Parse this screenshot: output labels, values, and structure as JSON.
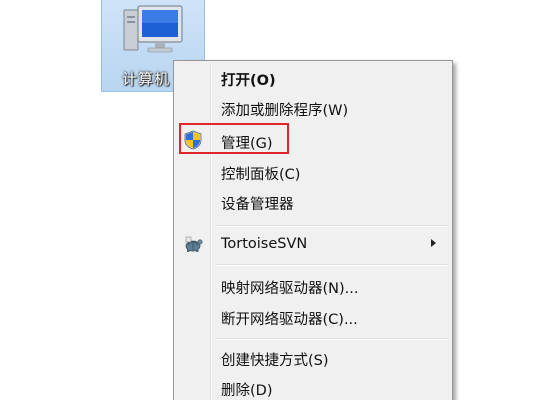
{
  "desktop": {
    "computer_label": "计算机"
  },
  "context_menu": {
    "items": [
      {
        "label": "打开(O)"
      },
      {
        "label": "添加或删除程序(W)"
      },
      {
        "label": "管理(G)"
      },
      {
        "label": "控制面板(C)"
      },
      {
        "label": "设备管理器"
      },
      {
        "label": "TortoiseSVN"
      },
      {
        "label": "映射网络驱动器(N)..."
      },
      {
        "label": "断开网络驱动器(C)..."
      },
      {
        "label": "创建快捷方式(S)"
      },
      {
        "label": "删除(D)"
      }
    ]
  },
  "icons": {
    "manage": "uac-shield-icon",
    "tortoisesvn": "tortoise-icon",
    "submenu": "submenu-arrow-icon"
  },
  "colors": {
    "highlight": "#e0262b",
    "menu_background": "#f0f0f0",
    "selection": "#cfe3f7"
  }
}
